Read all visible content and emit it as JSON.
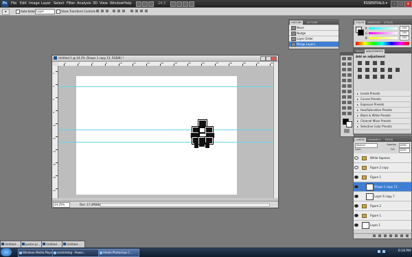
{
  "menubar": {
    "logo": "Ps",
    "items": [
      "File",
      "Edit",
      "Image",
      "Layer",
      "Select",
      "Filter",
      "Analysis",
      "3D",
      "View",
      "Window",
      "Help"
    ],
    "zoom": "24.3",
    "workspace": "ESSENTIALS ▾",
    "win_controls": [
      "–",
      "□",
      "✕"
    ]
  },
  "options": {
    "autoselect_label": "Auto-Select:",
    "autoselect_value": "Layer",
    "show_transform_label": "Show Transform Controls"
  },
  "document": {
    "title": "Untitled-1 @ 24.2% (Shape 1 copy 13, RGB/8) *",
    "zoom": "24.25%",
    "doc_size": "Doc: 17.2M/68.6M",
    "ruler_h": [
      "2",
      "4",
      "6",
      "8",
      "10",
      "12",
      "14",
      "16",
      "18",
      "20",
      "22",
      "24",
      "26",
      "28",
      "30",
      "32"
    ],
    "ruler_v": [
      "2",
      "4",
      "6",
      "8",
      "10",
      "12",
      "14",
      "16",
      "18",
      "20"
    ]
  },
  "history": {
    "tabs": [
      "HISTORY",
      "ACTIONS"
    ],
    "items": [
      "Move",
      "Nudge",
      "Layer Order",
      "Merge Layers"
    ],
    "selected_index": 3
  },
  "color": {
    "tabs": [
      "COLOR",
      "SWATCHES",
      "STYLES"
    ],
    "labels": [
      "R",
      "G",
      "B"
    ],
    "values": [
      "255",
      "255",
      "255"
    ]
  },
  "adjustments": {
    "tabs": [
      "MASKS",
      "ADJUSTMENTS"
    ],
    "header": "Add an adjustment",
    "presets": [
      "Levels Presets",
      "Curves Presets",
      "Exposure Presets",
      "Hue/Saturation Presets",
      "Black & White Presets",
      "Channel Mixer Presets",
      "Selective Color Presets"
    ]
  },
  "layers": {
    "tabs": [
      "LAYERS",
      "CHANNELS",
      "PATHS"
    ],
    "blend_mode": "Normal",
    "opacity_label": "Opacity:",
    "opacity_value": "100%",
    "lock_label": "Lock:",
    "fill_label": "Fill:",
    "fill_value": "100%",
    "items": [
      {
        "name": "White Squares",
        "kind": "folder",
        "eye": false,
        "indent": 0
      },
      {
        "name": "Figure 2 copy",
        "kind": "folder",
        "eye": false,
        "indent": 0
      },
      {
        "name": "Figure 1",
        "kind": "folder",
        "eye": true,
        "indent": 0
      },
      {
        "name": "Shape 1 copy 13",
        "kind": "layer",
        "eye": true,
        "indent": 1,
        "selected": true
      },
      {
        "name": "Layer 6 copy 7",
        "kind": "layer",
        "eye": true,
        "indent": 1
      },
      {
        "name": "Figure 2",
        "kind": "folder",
        "eye": true,
        "indent": 0
      },
      {
        "name": "Figure 1",
        "kind": "folder",
        "eye": true,
        "indent": 0
      },
      {
        "name": "Layer 1",
        "kind": "layer",
        "eye": true,
        "indent": 0
      }
    ]
  },
  "minimized_docs": [
    "Untitled-...",
    "poster-pl...",
    "Untitled-...",
    "Untitled-..."
  ],
  "taskbar": {
    "buttons": [
      "Windows Media Player",
      "slashdsdsg - Power...",
      "Adobe Photoshop C..."
    ],
    "clock": "6:18 PM"
  }
}
